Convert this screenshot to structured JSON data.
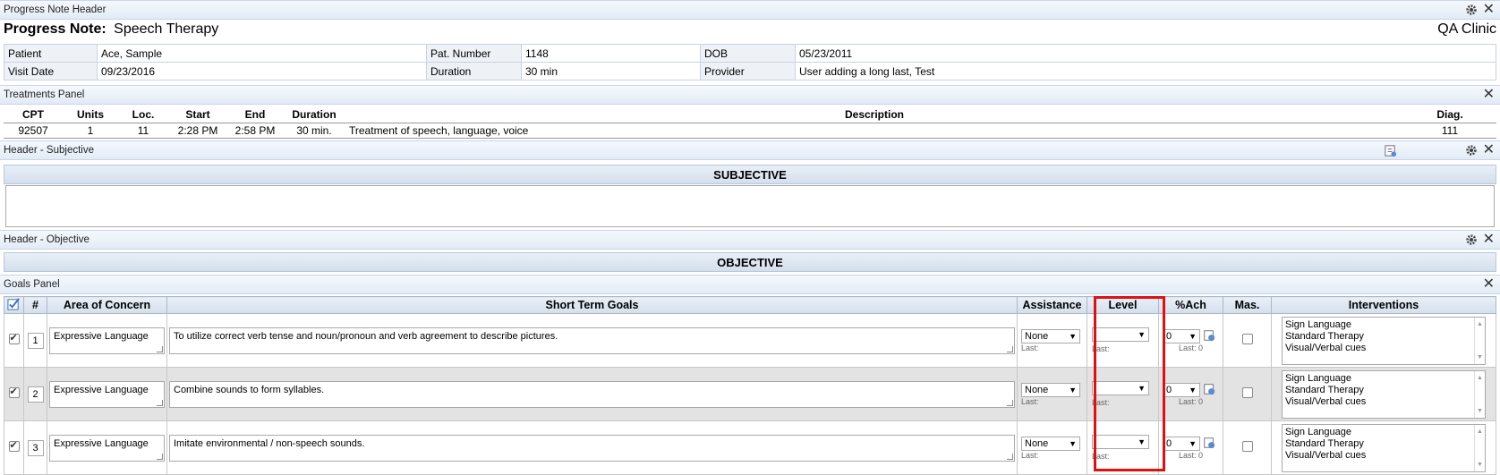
{
  "header_panel": {
    "title": "Progress Note Header",
    "note_label": "Progress Note:",
    "note_type": "Speech Therapy",
    "clinic": "QA Clinic",
    "patient_label": "Patient",
    "patient": "Ace, Sample",
    "pat_number_label": "Pat. Number",
    "pat_number": "1148",
    "dob_label": "DOB",
    "dob": "05/23/2011",
    "visit_date_label": "Visit Date",
    "visit_date": "09/23/2016",
    "duration_label": "Duration",
    "duration": "30 min",
    "provider_label": "Provider",
    "provider": "User adding a long last, Test"
  },
  "treatments_panel": {
    "title": "Treatments Panel",
    "columns": [
      "CPT",
      "Units",
      "Loc.",
      "Start",
      "End",
      "Duration",
      "Description",
      "Diag."
    ],
    "rows": [
      [
        "92507",
        "1",
        "11",
        "2:28 PM",
        "2:58 PM",
        "30 min.",
        "Treatment of speech, language, voice",
        "111"
      ]
    ]
  },
  "subjective_panel": {
    "title": "Header - Subjective",
    "section": "SUBJECTIVE",
    "value": ""
  },
  "objective_panel": {
    "title": "Header - Objective",
    "section": "OBJECTIVE"
  },
  "goals_panel": {
    "title": "Goals Panel",
    "columns": {
      "num": "#",
      "area": "Area of Concern",
      "stg": "Short Term Goals",
      "assistance": "Assistance",
      "level": "Level",
      "pct": "%Ach",
      "mas": "Mas.",
      "interventions": "Interventions"
    },
    "last_label": "Last:",
    "last_pct_label": "Last: 0",
    "rows": [
      {
        "num": "1",
        "area": "Expressive Language",
        "goal": "To utilize correct verb tense and noun/pronoun and verb agreement to describe pictures.",
        "assistance": "None",
        "level": "",
        "pct": "0",
        "interventions": [
          "Sign Language",
          "Standard Therapy",
          "Visual/Verbal cues"
        ]
      },
      {
        "num": "2",
        "area": "Expressive Language",
        "goal": "Combine sounds to form syllables.",
        "assistance": "None",
        "level": "",
        "pct": "0",
        "interventions": [
          "Sign Language",
          "Standard Therapy",
          "Visual/Verbal cues"
        ]
      },
      {
        "num": "3",
        "area": "Expressive Language",
        "goal": "Imitate environmental / non-speech sounds.",
        "assistance": "None",
        "level": "",
        "pct": "0",
        "interventions": [
          "Sign Language",
          "Standard Therapy",
          "Visual/Verbal cues"
        ]
      }
    ]
  },
  "colors": {
    "highlight": "#e01010",
    "panel_bar": "#e2ebf6"
  }
}
